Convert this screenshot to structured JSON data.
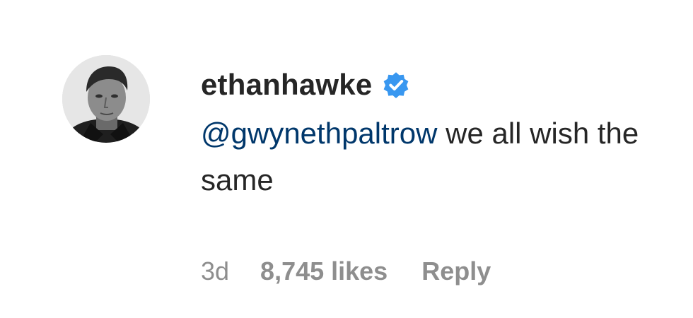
{
  "comment": {
    "avatar_icon": "profile-photo-icon",
    "username": "ethanhawke",
    "verified_icon": "verified-badge-icon",
    "verified_color": "#3897f0",
    "mention": "@gwynethpaltrow",
    "text": " we all wish the same",
    "mention_color": "#00376b",
    "time": "3d",
    "likes": "8,745 likes",
    "reply_label": "Reply"
  }
}
